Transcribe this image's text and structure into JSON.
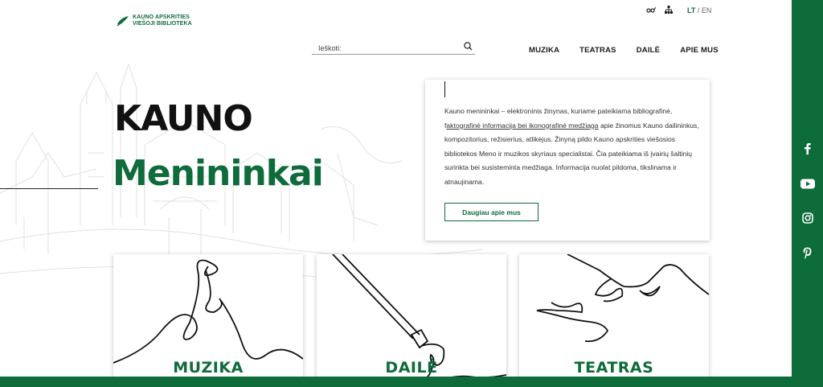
{
  "logo": {
    "line1": "KAUNO APSKRITIES",
    "line2": "VIEŠOJI BIBLIOTEKA"
  },
  "utils": {
    "lang_active": "LT",
    "lang_sep": " / ",
    "lang_other": "EN",
    "icons": [
      "accessibility-icon",
      "sitemap-icon"
    ]
  },
  "search": {
    "placeholder": "Ieškoti:"
  },
  "nav": {
    "items": [
      {
        "label": "MUZIKA"
      },
      {
        "label": "TEATRAS"
      },
      {
        "label": "DAILĖ"
      },
      {
        "label": "APIE MUS"
      }
    ]
  },
  "hero": {
    "line1": "KAUNO",
    "line2": "Menininkai"
  },
  "info": {
    "text_a": "Kauno menininkai – elektroninis žinynas, kuriame pateikiama bibliografinė, f",
    "text_link": "aktografinė informacija bei ikonografinė medžiaga",
    "text_b": " apie žinomus Kauno dailininkus, kompozitorius, režisierius, atlikėjus. Žinyną pildo Kauno apskrities viešosios bibliotekos Meno ir muzikos skyriaus specialistai. Čia pateikiama iš įvairių šaltinių surinkta bei susisteminta medžiaga. Informacija nuolat pildoma, tikslinama ir atnaujinama.",
    "button": "Daugiau apie mus"
  },
  "categories": [
    {
      "label": "MUZIKA"
    },
    {
      "label": "DAILĖ"
    },
    {
      "label": "TEATRAS"
    }
  ],
  "social": [
    "facebook-icon",
    "youtube-icon",
    "instagram-icon",
    "pinterest-icon"
  ],
  "colors": {
    "brand_green": "#0e6b3a",
    "text_dark": "#111111"
  }
}
